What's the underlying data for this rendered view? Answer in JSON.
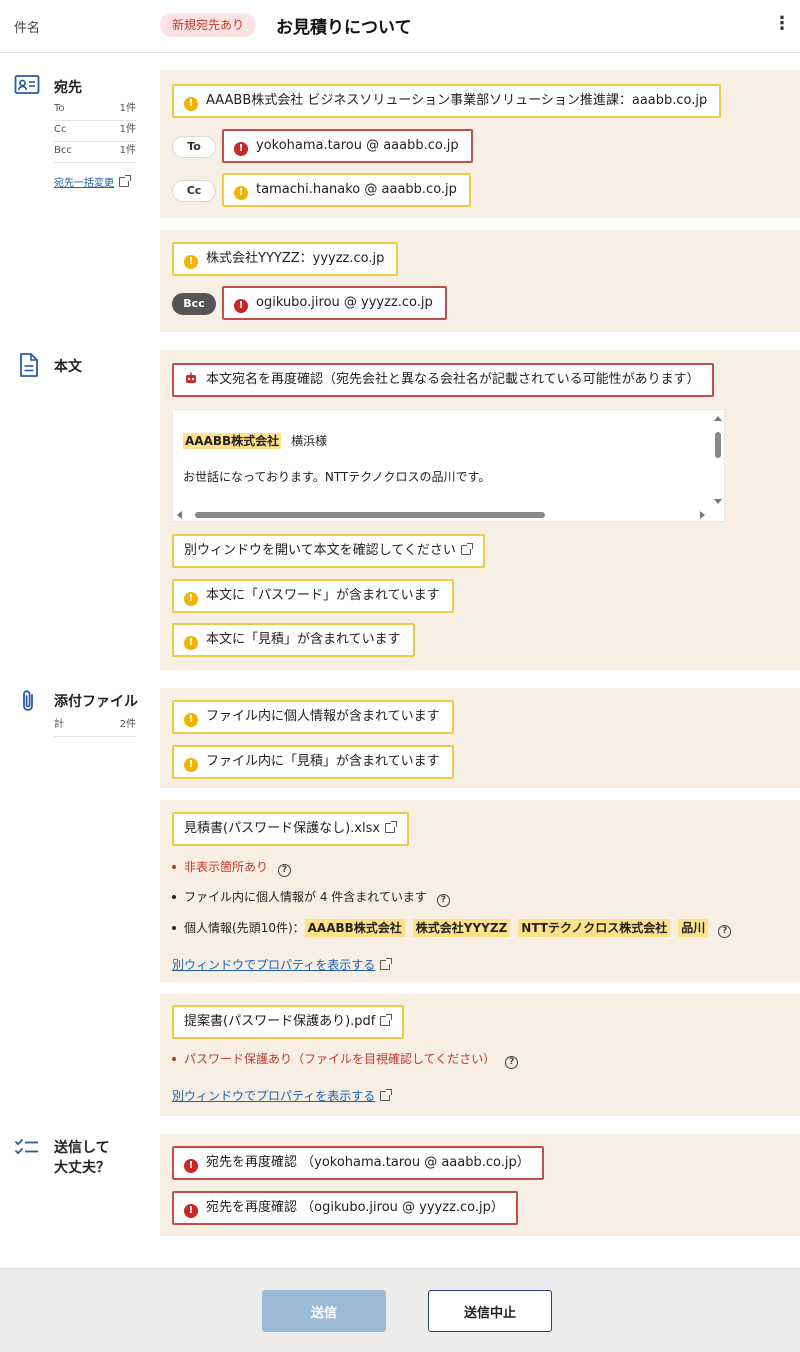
{
  "header": {
    "subject_label": "件名",
    "new_recipient_badge": "新規宛先あり",
    "subject": "お見積りについて",
    "menu_icon": "⋮"
  },
  "recipients": {
    "title": "宛先",
    "counts": [
      {
        "label": "To",
        "value": "1件"
      },
      {
        "label": "Cc",
        "value": "1件"
      },
      {
        "label": "Bcc",
        "value": "1件"
      }
    ],
    "bulk_change_link": "宛先一括変更",
    "group1": {
      "company": "AAABB株式会社 ビジネスソリューション事業部ソリューション推進課：aaabb.co.jp",
      "to_tag": "To",
      "to_address": "yokohama.tarou @ aaabb.co.jp",
      "cc_tag": "Cc",
      "cc_address": "tamachi.hanako @ aaabb.co.jp"
    },
    "group2": {
      "company": "株式会社YYYZZ：yyyzz.co.jp",
      "bcc_tag": "Bcc",
      "bcc_address": "ogikubo.jirou @ yyyzz.co.jp"
    }
  },
  "body": {
    "title": "本文",
    "alert": "本文宛名を再度確認（宛先会社と異なる会社名が記載されている可能性があります）",
    "preview": {
      "company": "AAABB株式会社",
      "name": "横浜様",
      "greeting": "お世話になっております。NTTテクノクロスの品川です。"
    },
    "open_window": "別ウィンドウを開いて本文を確認してください",
    "password_warning": "本文に「パスワード」が含まれています",
    "estimate_warning": "本文に「見積」が含まれています"
  },
  "attachments": {
    "title": "添付ファイル",
    "total_label": "計",
    "total_value": "2件",
    "personal_info_warning": "ファイル内に個人情報が含まれています",
    "estimate_warning": "ファイル内に「見積」が含まれています",
    "file1": {
      "name": "見積書(パスワード保護なし).xlsx",
      "hidden": "非表示箇所あり",
      "pi_count": "ファイル内に個人情報が 4 件含まれています",
      "pi_label": "個人情報(先頭10件)：",
      "pi_items": [
        "AAABB株式会社",
        "株式会社YYYZZ",
        "NTTテクノクロス株式会社",
        "品川"
      ],
      "props_link": "別ウィンドウでプロパティを表示する"
    },
    "file2": {
      "name": "提案書(パスワード保護あり).pdf",
      "password_note": "パスワード保護あり（ファイルを目視確認してください）",
      "props_link": "別ウィンドウでプロパティを表示する"
    }
  },
  "confirm": {
    "title_line1": "送信して",
    "title_line2": "大丈夫？",
    "recheck1": "宛先を再度確認 （yokohama.tarou @ aaabb.co.jp）",
    "recheck2": "宛先を再度確認 （ogikubo.jirou @ yyyzz.co.jp）"
  },
  "footer": {
    "send": "送信",
    "cancel": "送信中止"
  },
  "colors": {
    "panel_bg": "#f7efe4",
    "warning_border": "#efc94c",
    "error_border": "#c0504d",
    "highlight": "#ffe18a",
    "link": "#1f5fae",
    "send_button": "#9bbad6"
  }
}
